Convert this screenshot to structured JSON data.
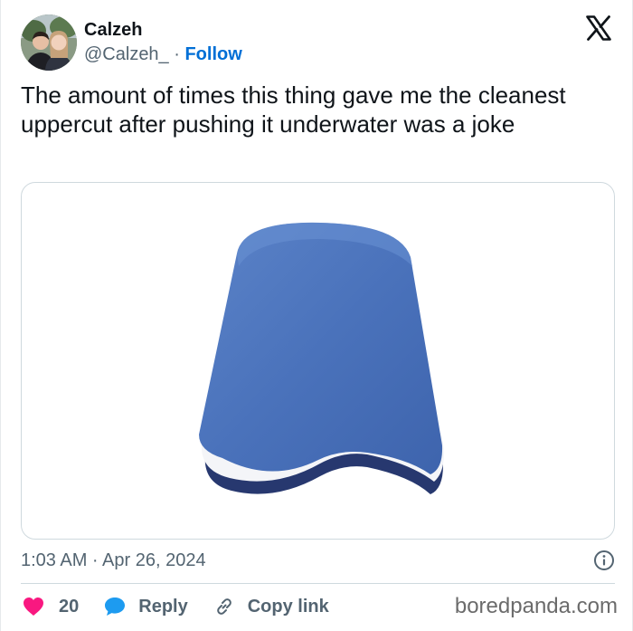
{
  "author": {
    "display_name": "Calzeh",
    "handle": "@Calzeh_",
    "separator": " · ",
    "follow_label": "Follow"
  },
  "brand_icon": "x-logo-icon",
  "tweet": {
    "text": "The amount of times this thing gave me the cleanest uppercut after pushing it underwater was a joke"
  },
  "media": {
    "subject": "blue-white-kickboard"
  },
  "meta": {
    "timestamp": "1:03 AM · Apr 26, 2024"
  },
  "actions": {
    "likes": "20",
    "reply_label": "Reply",
    "copy_label": "Copy link"
  },
  "watermark": "boredpanda.com",
  "colors": {
    "accent": "#006fd6",
    "like": "#f91880",
    "reply": "#1d9bf0",
    "muted": "#536471",
    "board_blue": "#4a72bb",
    "board_navy": "#2c3f7a"
  }
}
